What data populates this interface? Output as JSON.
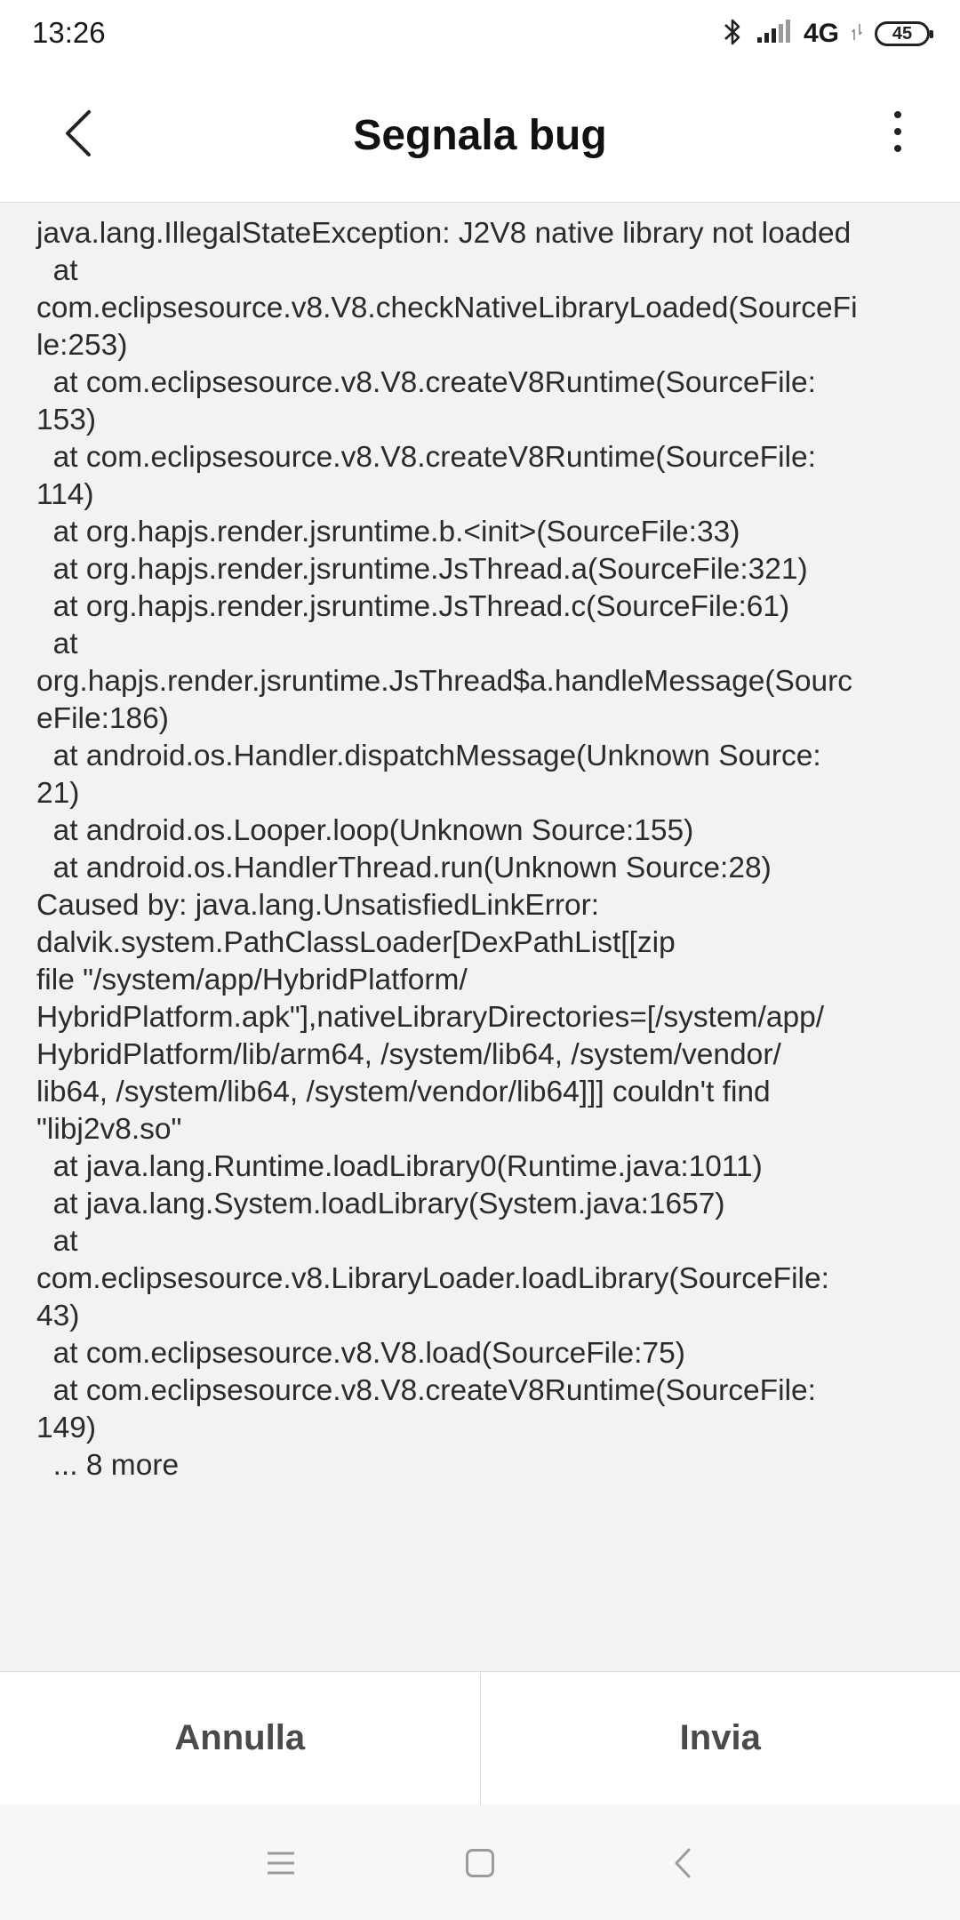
{
  "status_bar": {
    "time": "13:26",
    "network": "4G",
    "battery": "45",
    "icons": [
      "bluetooth-icon",
      "signal-icon",
      "battery-icon"
    ]
  },
  "header": {
    "title": "Segnala bug",
    "back_icon": "back-arrow-icon",
    "menu_icon": "more-vert-icon"
  },
  "log": {
    "lines": [
      "java.lang.IllegalStateException: J2V8 native library not loaded",
      "  at",
      "com.eclipsesource.v8.V8.checkNativeLibraryLoaded(SourceFi",
      "le:253)",
      "  at com.eclipsesource.v8.V8.createV8Runtime(SourceFile:",
      "153)",
      "  at com.eclipsesource.v8.V8.createV8Runtime(SourceFile:",
      "114)",
      "  at org.hapjs.render.jsruntime.b.<init>(SourceFile:33)",
      "  at org.hapjs.render.jsruntime.JsThread.a(SourceFile:321)",
      "  at org.hapjs.render.jsruntime.JsThread.c(SourceFile:61)",
      "  at",
      "org.hapjs.render.jsruntime.JsThread$a.handleMessage(Sourc",
      "eFile:186)",
      "  at android.os.Handler.dispatchMessage(Unknown Source:",
      "21)",
      "  at android.os.Looper.loop(Unknown Source:155)",
      "  at android.os.HandlerThread.run(Unknown Source:28)",
      "Caused by: java.lang.UnsatisfiedLinkError:",
      "dalvik.system.PathClassLoader[DexPathList[[zip",
      "file \"/system/app/HybridPlatform/",
      "HybridPlatform.apk\"],nativeLibraryDirectories=[/system/app/",
      "HybridPlatform/lib/arm64, /system/lib64, /system/vendor/",
      "lib64, /system/lib64, /system/vendor/lib64]]] couldn't find",
      "\"libj2v8.so\"",
      "  at java.lang.Runtime.loadLibrary0(Runtime.java:1011)",
      "  at java.lang.System.loadLibrary(System.java:1657)",
      "  at",
      "com.eclipsesource.v8.LibraryLoader.loadLibrary(SourceFile:",
      "43)",
      "  at com.eclipsesource.v8.V8.load(SourceFile:75)",
      "  at com.eclipsesource.v8.V8.createV8Runtime(SourceFile:",
      "149)",
      "  ... 8 more"
    ]
  },
  "actions": {
    "cancel_label": "Annulla",
    "send_label": "Invia"
  },
  "nav": {
    "icons": [
      "menu-icon",
      "home-icon",
      "back-icon"
    ]
  },
  "colors": {
    "background": "#f2f2f2",
    "surface": "#ffffff",
    "text": "#2b2b2b",
    "button_text": "#4a4a4a"
  }
}
